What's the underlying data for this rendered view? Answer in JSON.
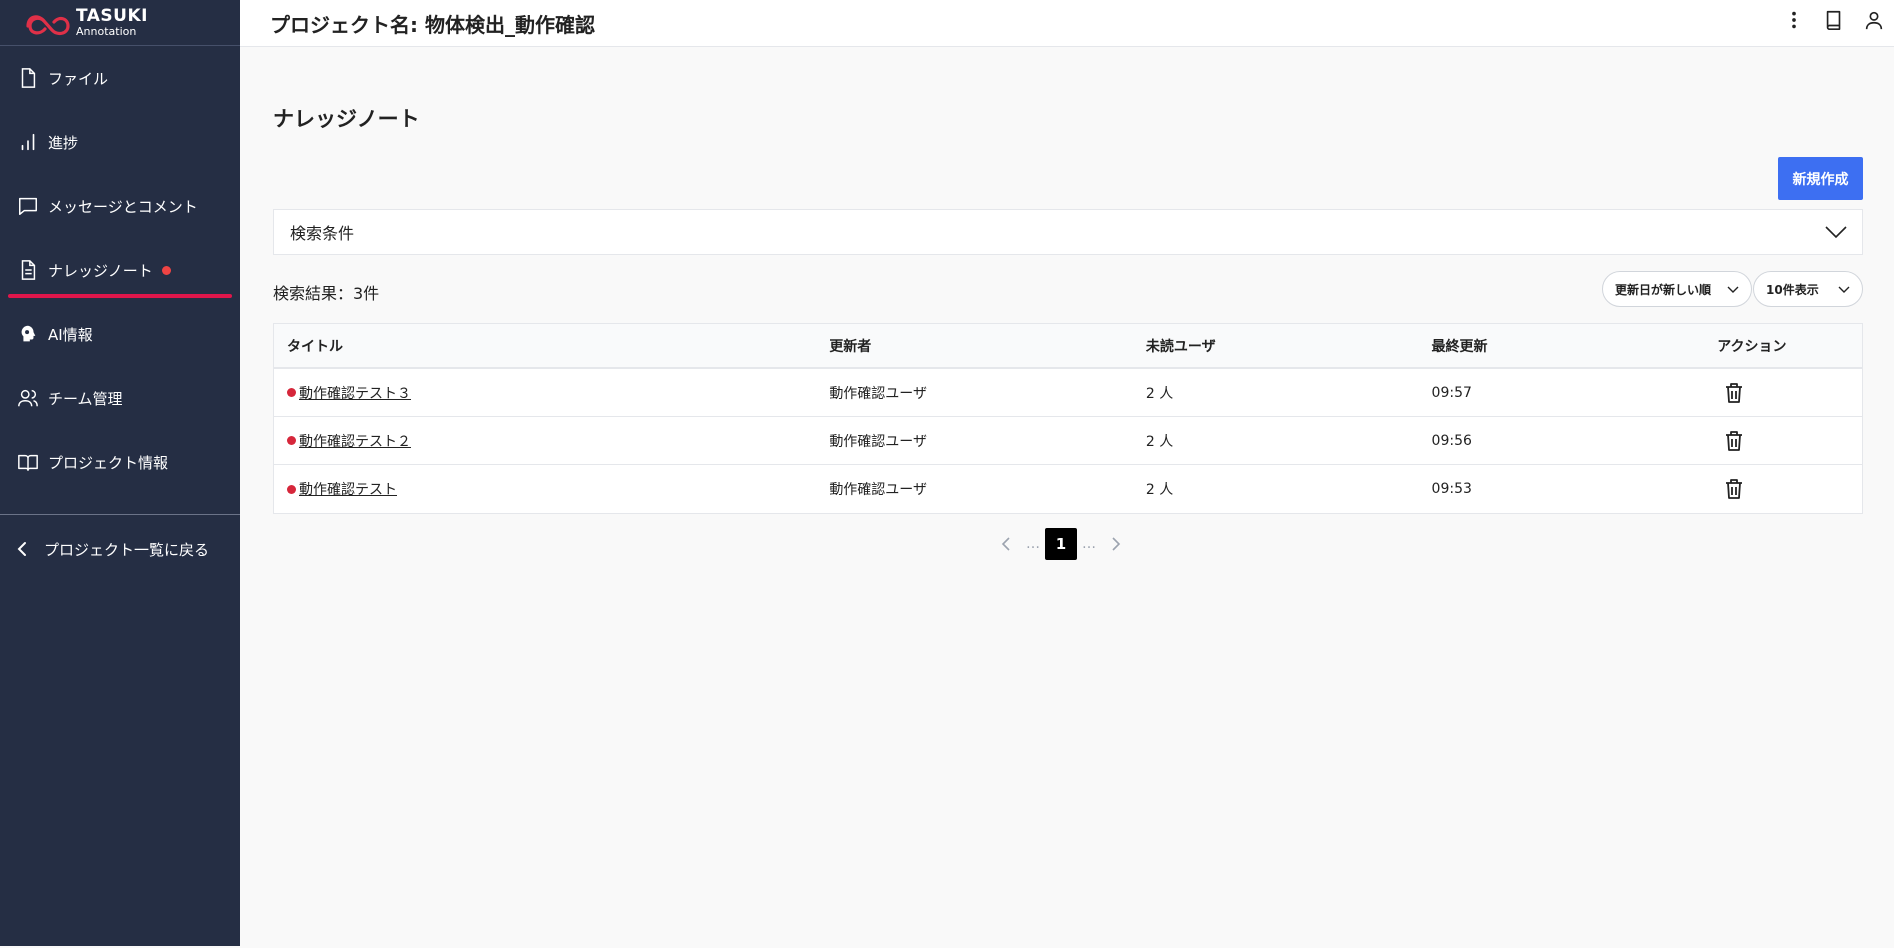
{
  "app": {
    "logo_title": "TASUKI",
    "logo_sub": "Annotation"
  },
  "header": {
    "title": "プロジェクト名: 物体検出_動作確認",
    "icons": [
      "more-vert-icon",
      "book-icon",
      "user-icon"
    ]
  },
  "sidebar": {
    "items": [
      {
        "label": "ファイル",
        "icon": "file-icon"
      },
      {
        "label": "進捗",
        "icon": "bar-chart-icon"
      },
      {
        "label": "メッセージとコメント",
        "icon": "message-icon"
      },
      {
        "label": "ナレッジノート",
        "icon": "document-icon",
        "active": true,
        "unread_dot": true
      },
      {
        "label": "AI情報",
        "icon": "ai-head-icon"
      },
      {
        "label": "チーム管理",
        "icon": "team-icon"
      },
      {
        "label": "プロジェクト情報",
        "icon": "open-book-icon"
      }
    ],
    "back_label": "プロジェクト一覧に戻る"
  },
  "main": {
    "page_title": "ナレッジノート",
    "new_button": "新規作成",
    "search_conditions": "検索条件",
    "result_count": "検索結果：3件",
    "sort_select": "更新日が新しい順",
    "per_page_select": "10件表示",
    "table": {
      "headers": [
        "タイトル",
        "更新者",
        "未読ユーザ",
        "最終更新",
        "アクション"
      ],
      "rows": [
        {
          "title": "動作確認テスト３",
          "updater": "動作確認ユーザ",
          "unread": "2 人",
          "updated": "09:57"
        },
        {
          "title": "動作確認テスト２",
          "updater": "動作確認ユーザ",
          "unread": "2 人",
          "updated": "09:56"
        },
        {
          "title": "動作確認テスト",
          "updater": "動作確認ユーザ",
          "unread": "2 人",
          "updated": "09:53"
        }
      ]
    },
    "pagination": {
      "ellipsis": "…",
      "current_page": "1"
    }
  },
  "colors": {
    "sidebar_bg": "#252e44",
    "accent": "#3d6ff2",
    "active_underline": "#e0164b",
    "unread_dot": "#d6273b"
  }
}
